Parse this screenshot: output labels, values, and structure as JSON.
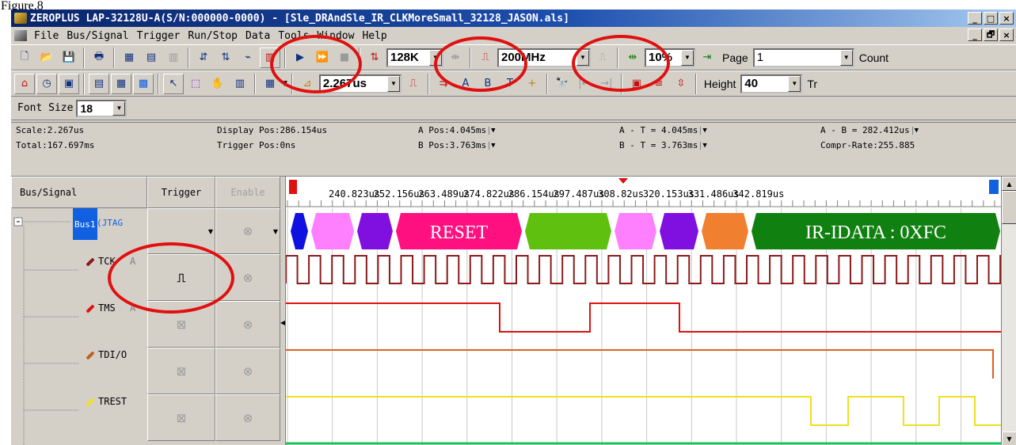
{
  "caption": "Figure.8",
  "window": {
    "title": "ZEROPLUS LAP-32128U-A(S/N:000000-0000) - [Sle_DRAndSle_IR_CLKMoreSmall_32128_JASON.als]",
    "min": "_",
    "max": "□",
    "close": "×",
    "restore": "🗗"
  },
  "menu": [
    "File",
    "Bus/Signal",
    "Trigger",
    "Run/Stop",
    "Data",
    "Tools",
    "Window",
    "Help"
  ],
  "toolbar1": {
    "memory_depth": "128K",
    "sample_rate": "200MHz",
    "zoom": "10%",
    "page_label": "Page",
    "page_value": "1",
    "count_label": "Count"
  },
  "toolbar2": {
    "scale_value": "2.267us",
    "height_label": "Height",
    "height_value": "40",
    "trailing_label": "Tr"
  },
  "font_size": {
    "label": "Font Size",
    "value": "18"
  },
  "info": {
    "scale": "Scale:2.267us",
    "total": "Total:167.697ms",
    "display_pos": "Display Pos:286.154us",
    "trigger_pos": "Trigger Pos:0ns",
    "a_pos": "A Pos:4.045ms",
    "b_pos": "B Pos:3.763ms",
    "a_t": "A - T = 4.045ms",
    "b_t": "B - T = 3.763ms",
    "a_b": "A - B = 282.412us",
    "compr_rate": "Compr-Rate:255.885"
  },
  "columns": {
    "bus_signal": "Bus/Signal",
    "trigger": "Trigger",
    "enable": "Enable"
  },
  "bus": {
    "label": "Bus1",
    "sub": "(JTAG"
  },
  "signals": [
    {
      "name": "TCK",
      "suffix": "A",
      "color": "#8b1a1a"
    },
    {
      "name": "TMS",
      "suffix": "A",
      "color": "#e01010"
    },
    {
      "name": "TDI/O",
      "suffix": "",
      "color": "#d0601a"
    },
    {
      "name": "TREST",
      "suffix": "",
      "color": "#f0e020"
    }
  ],
  "time_ticks": [
    "240.823us",
    "252.156us",
    "263.489us",
    "274.822us",
    "286.154us",
    "297.487us",
    "308.82us",
    "320.153us",
    "331.486us",
    "342.819us"
  ],
  "bus_segments": [
    {
      "label": "",
      "color": "#1010e0"
    },
    {
      "label": "",
      "color": "#ff80ff"
    },
    {
      "label": "",
      "color": "#8010e0"
    },
    {
      "label": "RESET",
      "color": "#ff1080"
    },
    {
      "label": "",
      "color": "#60c010"
    },
    {
      "label": "",
      "color": "#ff80ff"
    },
    {
      "label": "",
      "color": "#8010e0"
    },
    {
      "label": "",
      "color": "#f08030"
    },
    {
      "label": "IR-IDATA : 0XFC",
      "color": "#108010"
    }
  ],
  "colors": {
    "highlight": "#e01010",
    "tck": "#8b1a1a",
    "tms": "#e01010",
    "tdi": "#e06020",
    "trest": "#f0e020",
    "next": "#20c060"
  }
}
